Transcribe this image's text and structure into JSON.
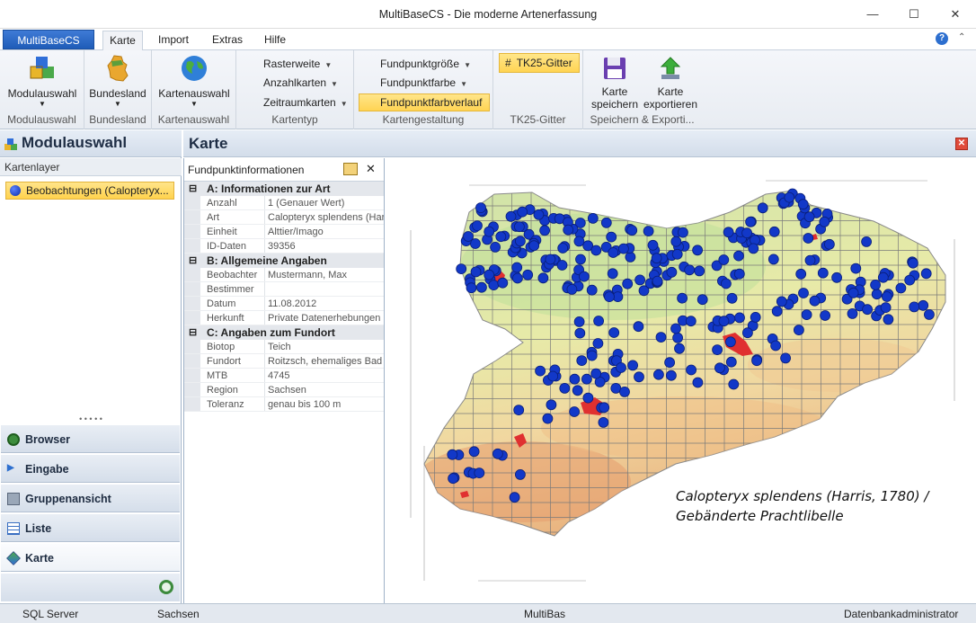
{
  "window": {
    "title": "MultiBaseCS - Die moderne Artenerfassung"
  },
  "ribbon_tabs": {
    "app": "MultiBaseCS",
    "tabs": [
      "Karte",
      "Import",
      "Extras",
      "Hilfe"
    ],
    "active": "Karte"
  },
  "ribbon": {
    "modul": {
      "button": "Modulauswahl",
      "group": "Modulauswahl"
    },
    "bundesland": {
      "button": "Bundesland",
      "group": "Bundesland"
    },
    "kartenauswahl": {
      "button": "Kartenauswahl",
      "group": "Kartenauswahl"
    },
    "kartentyp": {
      "items": [
        "Rasterweite",
        "Anzahlkarten",
        "Zeitraumkarten"
      ],
      "group": "Kartentyp"
    },
    "kartengestaltung": {
      "items": [
        "Fundpunktgröße",
        "Fundpunktfarbe",
        "Fundpunktfarbverlauf"
      ],
      "group": "Kartengestaltung"
    },
    "tk25": {
      "button": "TK25-Gitter",
      "group": "TK25-Gitter"
    },
    "speichern": {
      "save_line1": "Karte",
      "save_line2": "speichern",
      "export_line1": "Karte",
      "export_line2": "exportieren",
      "group": "Speichern & Exporti..."
    }
  },
  "left_pane": {
    "title": "Modulauswahl",
    "layer_header": "Kartenlayer",
    "layer_item": "Beobachtungen  (Calopteryx...",
    "nav": [
      "Browser",
      "Eingabe",
      "Gruppenansicht",
      "Liste",
      "Karte"
    ],
    "nav_active": "Karte"
  },
  "main": {
    "title": "Karte"
  },
  "info": {
    "title": "Fundpunktinformationen",
    "sections": [
      {
        "title": "A: Informationen zur Art",
        "rows": [
          {
            "k": "Anzahl",
            "v": "1 (Genauer Wert)"
          },
          {
            "k": "Art",
            "v": "Calopteryx splendens (Harr"
          },
          {
            "k": "Einheit",
            "v": "Alttier/Imago"
          },
          {
            "k": "ID-Daten",
            "v": "39356"
          }
        ]
      },
      {
        "title": "B: Allgemeine Angaben",
        "rows": [
          {
            "k": "Beobachter",
            "v": "Mustermann, Max"
          },
          {
            "k": "Bestimmer",
            "v": ""
          },
          {
            "k": "Datum",
            "v": "11.08.2012"
          },
          {
            "k": "Herkunft",
            "v": "Private Datenerhebungen"
          }
        ]
      },
      {
        "title": "C: Angaben zum Fundort",
        "rows": [
          {
            "k": "Biotop",
            "v": "Teich"
          },
          {
            "k": "Fundort",
            "v": "Roitzsch, ehemaliges Bad"
          },
          {
            "k": "MTB",
            "v": "4745"
          },
          {
            "k": "Region",
            "v": "Sachsen"
          },
          {
            "k": "Toleranz",
            "v": "genau bis 100 m"
          }
        ]
      }
    ]
  },
  "map": {
    "species_line1": "Calopteryx splendens (Harris, 1780) /",
    "species_line2": "Gebänderte Prachtlibelle",
    "point_color": "#1238c8"
  },
  "status": {
    "server": "SQL Server",
    "region": "Sachsen",
    "app": "MultiBas",
    "user": "Datenbankadministrator"
  }
}
